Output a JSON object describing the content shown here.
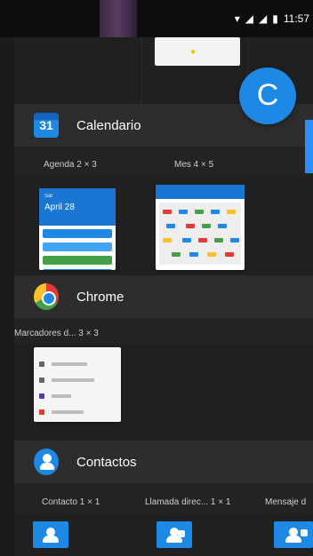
{
  "status_bar": {
    "time": "11:57",
    "icons": [
      "wifi-icon",
      "signal-icon",
      "signal-icon",
      "battery-icon"
    ]
  },
  "overlay": {
    "bubble_letter": "C",
    "accent": "#1E88E5"
  },
  "sections": [
    {
      "app_name": "Calendario",
      "icon": "calendar-icon",
      "icon_text": "31",
      "widgets": [
        {
          "label": "Agenda 2 × 3"
        },
        {
          "label": "Mes 4 × 5"
        }
      ],
      "agenda_preview": {
        "date": "April 28"
      }
    },
    {
      "app_name": "Chrome",
      "icon": "chrome-icon",
      "widgets": [
        {
          "label": "Marcadores d...  3 × 3"
        }
      ]
    },
    {
      "app_name": "Contactos",
      "icon": "contacts-icon",
      "widgets": [
        {
          "label": "Contacto 1 × 1"
        },
        {
          "label": "Llamada direc...  1 × 1"
        },
        {
          "label": "Mensaje d"
        }
      ]
    }
  ]
}
